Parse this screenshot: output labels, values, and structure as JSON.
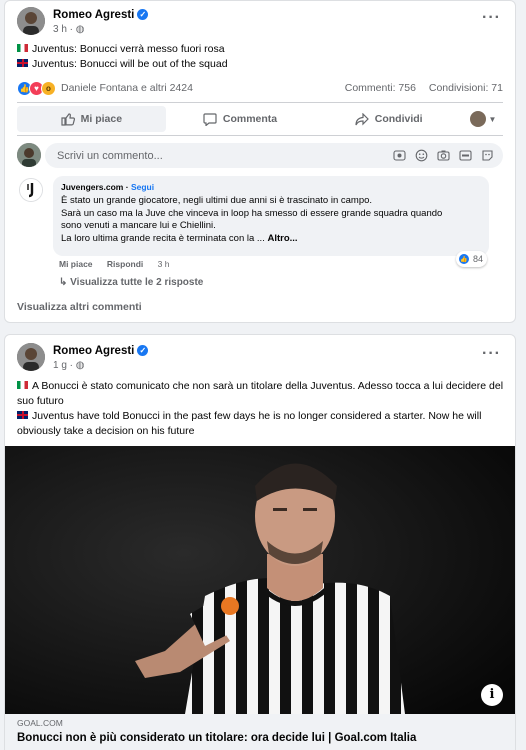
{
  "colors": {
    "accent": "#1877f2",
    "page_bg": "#f0f2f5",
    "muted": "#65676b"
  },
  "post1": {
    "author": "Romeo Agresti",
    "time": "3 h",
    "audience_icon": "globe-icon",
    "lines": [
      {
        "flag": "it",
        "text": "Juventus: Bonucci verrà messo fuori rosa"
      },
      {
        "flag": "uk",
        "text": "Juventus: Bonucci will be out of the squad"
      }
    ],
    "reaction_icons": [
      "like",
      "love",
      "wow"
    ],
    "reaction_names": "Daniele Fontana e altri 2424",
    "comments_count": "Commenti: 756",
    "shares_count": "Condivisioni: 71",
    "actions": {
      "like": "Mi piace",
      "comment": "Commenta",
      "share": "Condividi"
    },
    "compose_placeholder": "Scrivi un commento...",
    "comment": {
      "author": "Juvengers.com",
      "dot": "·",
      "follow": "Segui",
      "lines": [
        "È stato un grande giocatore, negli ultimi due anni si è trascinato in campo.",
        "Sarà un caso ma la Juve che vinceva in loop ha smesso di essere grande squadra quando",
        "sono venuti a mancare lui e Chiellini.",
        "La loro ultima grande recita è terminata con la ..."
      ],
      "more": "Altro...",
      "like": "Mi piace",
      "reply": "Rispondi",
      "time": "3 h",
      "reaction_count": "84"
    },
    "view_replies": "Visualizza tutte le 2 risposte",
    "view_more_comments": "Visualizza altri commenti"
  },
  "post2": {
    "author": "Romeo Agresti",
    "time": "1 g",
    "audience_icon": "globe-icon",
    "lines": [
      {
        "flag": "it",
        "text": "A Bonucci è stato comunicato che non sarà un titolare della Juventus. Adesso tocca a lui decidere del"
      },
      {
        "flag": "",
        "text": "suo futuro"
      },
      {
        "flag": "uk",
        "text": "Juventus have told Bonucci in the past few days he is no longer considered a starter. Now he will"
      },
      {
        "flag": "",
        "text": "obviously take a decision on his future"
      }
    ],
    "link": {
      "domain": "GOAL.COM",
      "title": "Bonucci non è più considerato un titolare: ora decide lui | Goal.com Italia",
      "image_icon": "photo-player-juventus"
    }
  }
}
